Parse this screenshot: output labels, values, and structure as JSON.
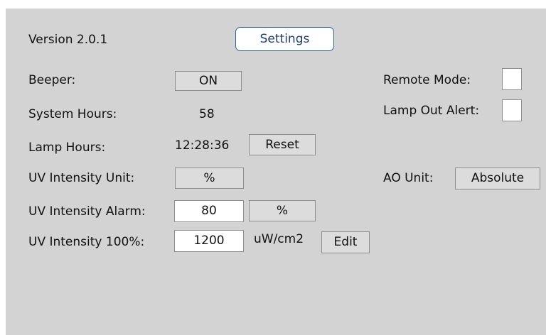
{
  "header": {
    "version_label": "Version 2.0.1",
    "settings_label": "Settings"
  },
  "beeper": {
    "label": "Beeper:",
    "value": "ON"
  },
  "system_hours": {
    "label": "System Hours:",
    "value": "58"
  },
  "lamp_hours": {
    "label": "Lamp Hours:",
    "value": "12:28:36",
    "reset_label": "Reset"
  },
  "uv_intensity_unit": {
    "label": "UV Intensity Unit:",
    "value": "%"
  },
  "uv_intensity_alarm": {
    "label": "UV Intensity Alarm:",
    "value": "80",
    "unit": "%"
  },
  "uv_intensity_100": {
    "label": "UV Intensity 100%:",
    "value": "1200",
    "unit": "uW/cm2",
    "edit_label": "Edit"
  },
  "remote_mode": {
    "label": "Remote Mode:",
    "checked": false
  },
  "lamp_out_alert": {
    "label": "Lamp Out Alert:",
    "checked": false
  },
  "ao_unit": {
    "label": "AO Unit:",
    "value": "Absolute"
  },
  "colors": {
    "panel_background": "#d3d3d3",
    "button_background": "#dcdcdc",
    "accent": "#2d5fa8"
  }
}
